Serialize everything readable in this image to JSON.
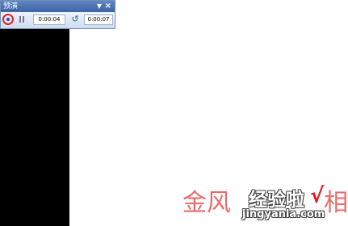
{
  "toolbar": {
    "title": "预演",
    "menu_icon": "dropdown-arrow-icon",
    "close_icon": "close-icon",
    "play_icon": "play-icon",
    "pause_icon": "pause-icon",
    "loop_icon": "loop-icon",
    "current_time": "0:00:04",
    "total_time": "0:00:07",
    "highlight_color": "#e0232b"
  },
  "watermark": {
    "text": "金风",
    "text_tail": "相",
    "logo_text": "经验啦",
    "logo_check": "√",
    "logo_url": "jingyanla.com"
  }
}
